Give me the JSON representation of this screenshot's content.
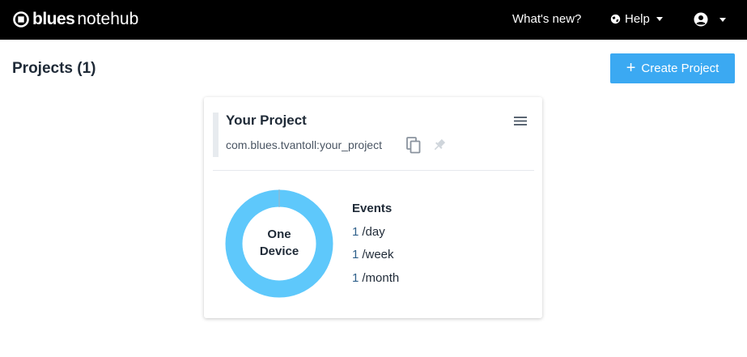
{
  "topbar": {
    "brand_bold": "blues",
    "brand_light": "notehub",
    "whats_new": "What's new?",
    "help": "Help"
  },
  "page": {
    "title": "Projects (1)",
    "create_button": "Create Project"
  },
  "project": {
    "name": "Your Project",
    "uid": "com.blues.tvantoll:your_project",
    "device_label_line1": "One",
    "device_label_line2": "Device",
    "device_count": 1,
    "events_title": "Events",
    "events": [
      {
        "count": "1",
        "period": "/day"
      },
      {
        "count": "1",
        "period": "/week"
      },
      {
        "count": "1",
        "period": "/month"
      }
    ]
  },
  "colors": {
    "topbar_bg": "#000000",
    "accent": "#3ba9f2",
    "donut": "#5ec8fb"
  },
  "icons": [
    "blues-logo-icon",
    "globe-icon",
    "account-circle-icon",
    "plus-icon",
    "copy-icon",
    "pin-icon",
    "hamburger-menu-icon"
  ]
}
